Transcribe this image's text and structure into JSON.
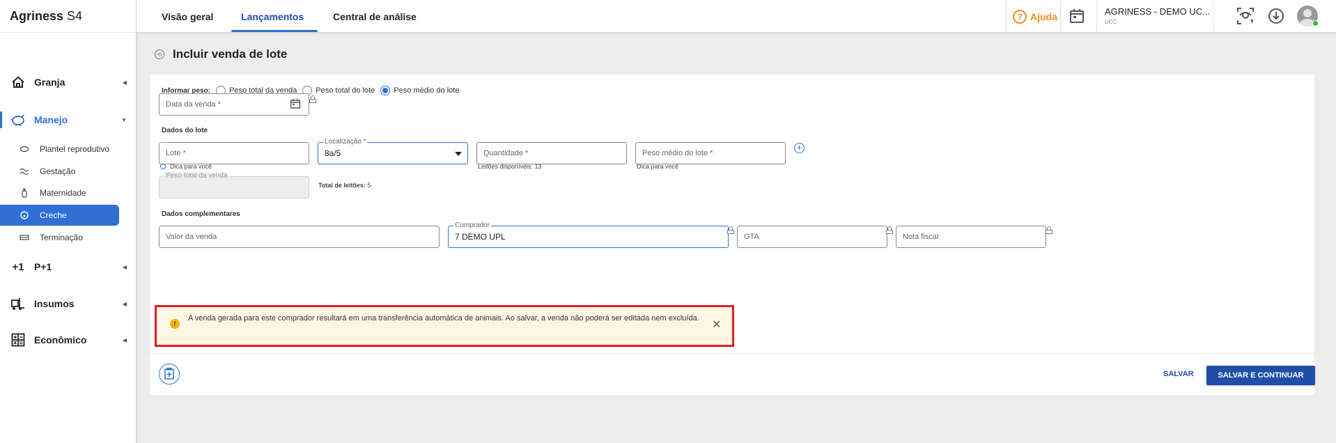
{
  "app": {
    "brand_bold": "Agriness",
    "brand_rest": "S4"
  },
  "sidebar": {
    "groups": [
      {
        "label": "Granja",
        "icon": "house-icon"
      },
      {
        "label": "Manejo",
        "icon": "piggy-icon"
      },
      {
        "label": "P+1",
        "icon": "plus-one-icon"
      },
      {
        "label": "Insumos",
        "icon": "forklift-icon"
      },
      {
        "label": "Econômico",
        "icon": "calculator-icon"
      }
    ],
    "manejo_items": [
      {
        "label": "Plantel reprodutivo",
        "icon": "pig-icon"
      },
      {
        "label": "Gestação",
        "icon": "gestation-icon"
      },
      {
        "label": "Maternidade",
        "icon": "bottle-icon"
      },
      {
        "label": "Creche",
        "icon": "piglet-icon"
      },
      {
        "label": "Terminação",
        "icon": "feeder-icon"
      }
    ]
  },
  "topbar": {
    "tabs": [
      "Visão geral",
      "Lançamentos",
      "Central de análise"
    ],
    "help_label": "Ajuda",
    "account_name": "AGRINESS - DEMO UC...",
    "account_sub": "UCC"
  },
  "page": {
    "title": "Incluir venda de lote"
  },
  "form": {
    "weight_label": "Informar peso:",
    "weight_options": [
      "Peso total da venda",
      "Peso total do lote",
      "Peso médio do lote"
    ],
    "sale_date_placeholder": "Data da venda *",
    "lot_section": "Dados do lote",
    "lot_placeholder": "Lote *",
    "lot_hint": "Dica para você",
    "location_label": "Localização *",
    "location_value": "8a/5",
    "quantity_placeholder": "Quantidade *",
    "quantity_hint": "Leitões disponíveis: 13",
    "avg_weight_placeholder": "Peso médio do lote *",
    "avg_weight_hint": "Dica para você",
    "total_weight_label": "Peso total da venda",
    "total_piglets_label": "Total de leitões:",
    "total_piglets_value": "5",
    "extra_section": "Dados complementares",
    "sale_value_placeholder": "Valor da venda",
    "buyer_label": "Comprador",
    "buyer_value": "7 DEMO UPL",
    "gta_placeholder": "GTA",
    "invoice_placeholder": "Nota fiscal",
    "alert_text": "A venda gerada para este comprador resultará em uma transferência automática de animais. Ao salvar, a venda não poderá ser editada nem excluída."
  },
  "actions": {
    "save": "SALVAR",
    "save_continue": "SALVAR E CONTINUAR"
  },
  "colors": {
    "accent": "#2f6fd6",
    "primary_dark": "#1f4fa8",
    "help": "#f08c1e",
    "alert_border": "#e01f26",
    "alert_bg": "#fdf6e2"
  }
}
